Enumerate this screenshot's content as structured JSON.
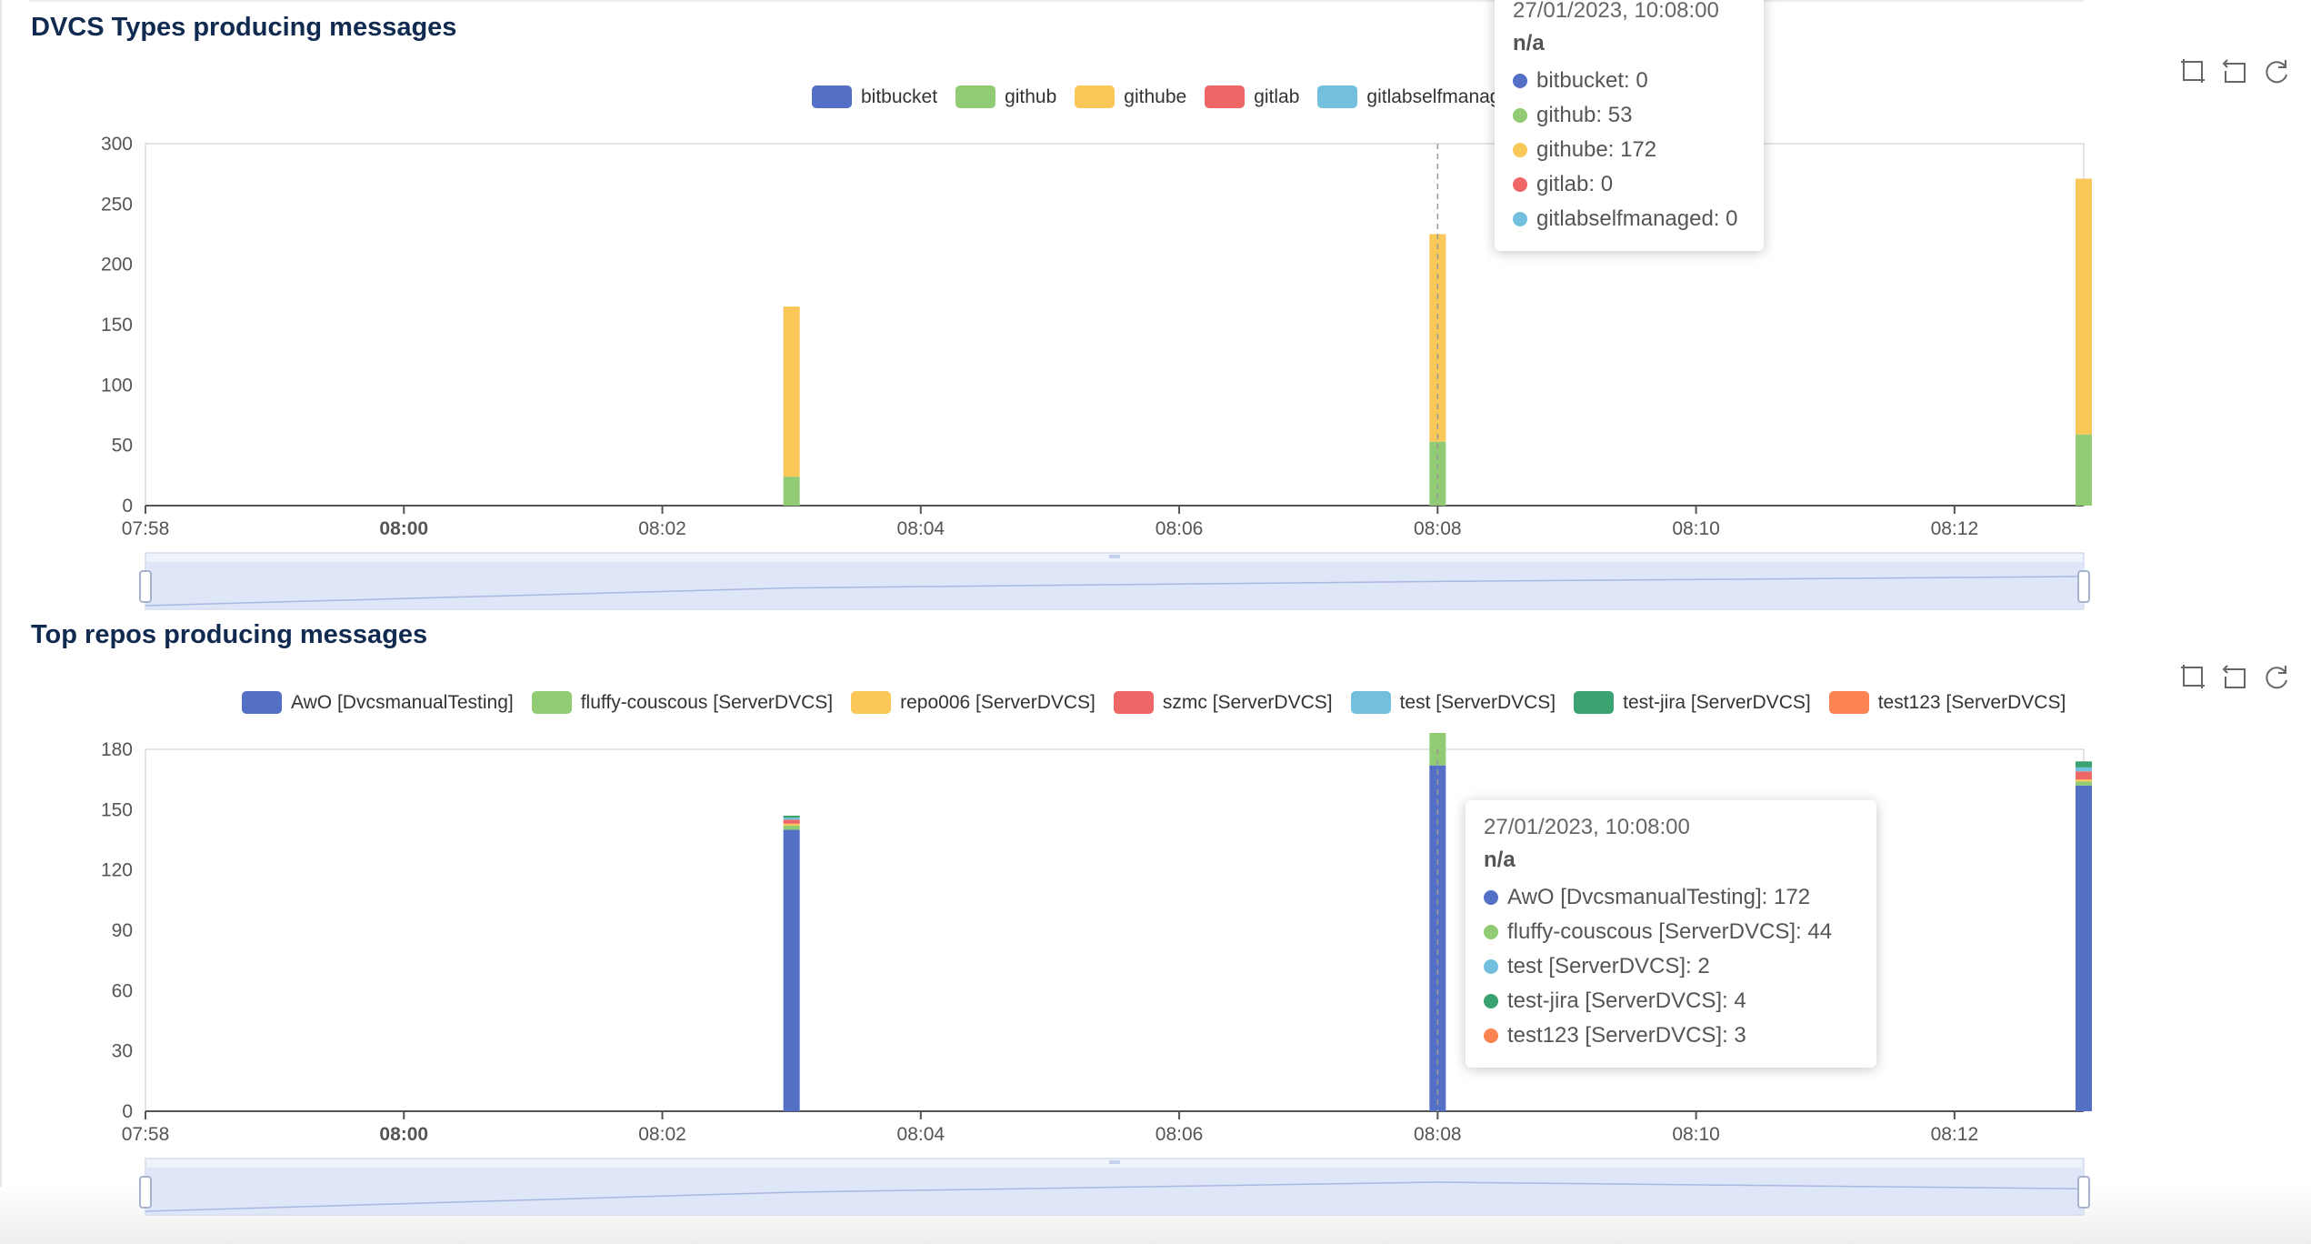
{
  "panels": [
    {
      "title": "DVCS Types producing messages",
      "tooltip": {
        "header": "27/01/2023, 10:08:00",
        "sub": "n/a",
        "rows": [
          {
            "label": "bitbucket: 0",
            "color": "#5470c6"
          },
          {
            "label": "github: 53",
            "color": "#91cc75"
          },
          {
            "label": "githube: 172",
            "color": "#fac858"
          },
          {
            "label": "gitlab: 0",
            "color": "#ee6666"
          },
          {
            "label": "gitlabselfmanaged: 0",
            "color": "#73c0de"
          }
        ]
      }
    },
    {
      "title": "Top repos producing messages",
      "tooltip": {
        "header": "27/01/2023, 10:08:00",
        "sub": "n/a",
        "rows": [
          {
            "label": "AwO [DvcsmanualTesting]: 172",
            "color": "#5470c6"
          },
          {
            "label": "fluffy-couscous [ServerDVCS]: 44",
            "color": "#91cc75"
          },
          {
            "label": "test [ServerDVCS]: 2",
            "color": "#73c0de"
          },
          {
            "label": "test-jira [ServerDVCS]: 4",
            "color": "#3ba272"
          },
          {
            "label": "test123 [ServerDVCS]: 3",
            "color": "#fc8452"
          }
        ]
      }
    }
  ],
  "toolbox": [
    "zoom-icon",
    "zoom-reset-icon",
    "restore-icon"
  ],
  "chart_data": [
    {
      "type": "bar",
      "stacked": true,
      "x_ticks": [
        "07:58",
        "08:00",
        "08:02",
        "08:04",
        "08:06",
        "08:08",
        "08:10",
        "08:12"
      ],
      "x_bold_tick": "08:00",
      "ylim": [
        0,
        300
      ],
      "y_ticks": [
        0,
        50,
        100,
        150,
        200,
        250,
        300
      ],
      "legend_position": "top-center",
      "x_min": "07:58",
      "x_max": "08:13",
      "x": [
        "08:03",
        "08:08",
        "08:13"
      ],
      "series": [
        {
          "name": "bitbucket",
          "color": "#5470c6",
          "values": [
            0,
            0,
            0
          ]
        },
        {
          "name": "github",
          "color": "#91cc75",
          "values": [
            24,
            53,
            59
          ]
        },
        {
          "name": "githube",
          "color": "#fac858",
          "values": [
            141,
            172,
            212
          ]
        },
        {
          "name": "gitlab",
          "color": "#ee6666",
          "values": [
            0,
            0,
            0
          ]
        },
        {
          "name": "gitlabselfmanaged",
          "color": "#73c0de",
          "values": [
            0,
            0,
            0
          ]
        }
      ],
      "hover_x": "08:08"
    },
    {
      "type": "bar",
      "stacked": true,
      "x_ticks": [
        "07:58",
        "08:00",
        "08:02",
        "08:04",
        "08:06",
        "08:08",
        "08:10",
        "08:12"
      ],
      "x_bold_tick": "08:00",
      "ylim": [
        0,
        180
      ],
      "y_ticks": [
        0,
        30,
        60,
        90,
        120,
        150,
        180
      ],
      "legend_position": "top-center",
      "x_min": "07:58",
      "x_max": "08:13",
      "x": [
        "08:03",
        "08:08",
        "08:13"
      ],
      "series": [
        {
          "name": "AwO [DvcsmanualTesting]",
          "color": "#5470c6",
          "values": [
            140,
            172,
            162
          ]
        },
        {
          "name": "fluffy-couscous [ServerDVCS]",
          "color": "#91cc75",
          "values": [
            2,
            44,
            2
          ]
        },
        {
          "name": "repo006 [ServerDVCS]",
          "color": "#fac858",
          "values": [
            1,
            0,
            1
          ]
        },
        {
          "name": "szmc [ServerDVCS]",
          "color": "#ee6666",
          "values": [
            2,
            0,
            4
          ]
        },
        {
          "name": "test [ServerDVCS]",
          "color": "#73c0de",
          "values": [
            1,
            2,
            2
          ]
        },
        {
          "name": "test-jira [ServerDVCS]",
          "color": "#3ba272",
          "values": [
            1,
            4,
            3
          ]
        },
        {
          "name": "test123 [ServerDVCS]",
          "color": "#fc8452",
          "values": [
            0,
            3,
            0
          ]
        }
      ],
      "hover_x": "08:08"
    }
  ]
}
